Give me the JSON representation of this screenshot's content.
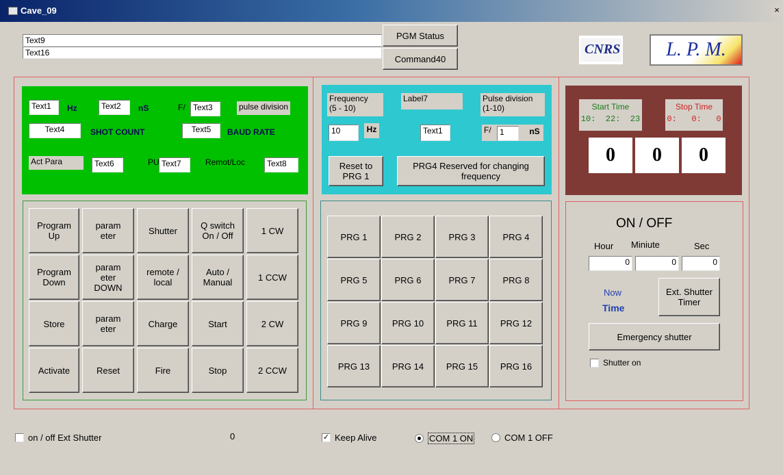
{
  "window": {
    "title": "Cave_09",
    "close": "×"
  },
  "top": {
    "text9": "Text9",
    "text16": "Text16",
    "pgm_status": "PGM Status",
    "command40": "Command40",
    "logo1": "CNRS",
    "logo2": "L. P. M."
  },
  "green": {
    "text1": "Text1",
    "hz": "Hz",
    "text2": "Text2",
    "ns": "nS",
    "f_slash": "F/",
    "text3": "Text3",
    "pulse_division": "pulse division",
    "text4": "Text4",
    "shot_count": "SHOT COUNT",
    "text5": "Text5",
    "baud_rate": "BAUD RATE",
    "act_para": "Act Para",
    "text6": "Text6",
    "pu": "PU",
    "text7": "Text7",
    "remot_loc": "Remot/Loc",
    "text8": "Text8"
  },
  "cyan": {
    "frequency": "Frequency\n(5 - 10)",
    "label7": "Label7",
    "pulse_division": "Pulse division\n(1-10)",
    "freq_value": "10",
    "hz": "Hz",
    "text1": "Text1",
    "f_slash": "F/",
    "pulse_value": "1",
    "ns": "nS",
    "reset_prg1": "Reset to\nPRG 1",
    "prg4_reserved": "PRG4 Reserved for changing\n        frequency"
  },
  "brown": {
    "start_time_label": "Start Time",
    "start_time_value": "10:  22:  23",
    "stop_time_label": "Stop Time",
    "stop_time_value": "0:   0:   0",
    "digits": [
      "0",
      "0",
      "0"
    ]
  },
  "controls": {
    "rows": [
      [
        "Program\nUp",
        "param\neter",
        "Shutter",
        "Q switch\nOn / Off",
        "1 CW"
      ],
      [
        "Program\nDown",
        "param\neter\nDOWN",
        "remote /\nlocal",
        "Auto /\nManual",
        "1 CCW"
      ],
      [
        "Store",
        "param\neter",
        "Charge",
        "Start",
        "2 CW"
      ],
      [
        "Activate",
        "Reset",
        "Fire",
        "Stop",
        "2 CCW"
      ]
    ]
  },
  "prg": {
    "rows": [
      [
        "PRG 1",
        "PRG 2",
        "PRG 3",
        "PRG 4"
      ],
      [
        "PRG 5",
        "PRG 6",
        "PRG 7",
        "PRG 8"
      ],
      [
        "PRG 9",
        "PRG 10",
        "PRG 11",
        "PRG 12"
      ],
      [
        "PRG 13",
        "PRG 14",
        "PRG 15",
        "PRG 16"
      ]
    ]
  },
  "timer": {
    "title": "ON / OFF",
    "hour": "Hour",
    "minute": "Miniute",
    "sec": "Sec",
    "hour_value": "0",
    "minute_value": "0",
    "sec_value": "0",
    "now": "Now",
    "time": "Time",
    "ext_shutter_timer": "Ext. Shutter\nTimer",
    "emergency_shutter": "Emergency shutter",
    "shutter_on": "Shutter on"
  },
  "bottom": {
    "ext_shutter": "on / off Ext Shutter",
    "counter": "0",
    "keep_alive": "Keep Alive",
    "com1_on": "COM 1 ON",
    "com1_off": "COM 1 OFF"
  },
  "colors": {
    "green_panel": "#00c000",
    "cyan_panel": "#2ec8d0",
    "brown_panel": "#7f3a36",
    "frame_red": "#e06060"
  }
}
